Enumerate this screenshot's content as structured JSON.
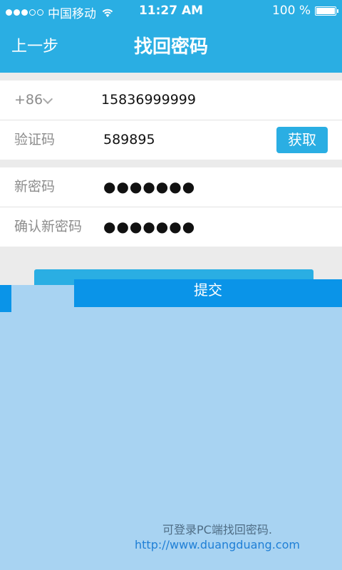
{
  "status_bar": {
    "carrier": "中国移动",
    "time": "11:27 AM",
    "battery": "100 %",
    "battery_level": 1.0,
    "signal_bars_filled": 3,
    "signal_bars_total": 5
  },
  "nav": {
    "back_label": "上一步",
    "title": "找回密码"
  },
  "form": {
    "country_code": "+86",
    "phone": "15836999999",
    "code_label": "验证码",
    "code_value": "589895",
    "get_code_label": "获取",
    "new_password_label": "新密码",
    "new_password_value": "●●●●●●●",
    "confirm_password_label": "确认新密码",
    "confirm_password_value": "●●●●●●●"
  },
  "submit_label": "提交",
  "footer": {
    "note": "可登录PC端找回密码.",
    "link": "http://www.duangduang.com"
  },
  "colors": {
    "primary": "#2aaee3",
    "submit": "#0a94e8",
    "lower_bg": "#a8d3f2"
  }
}
